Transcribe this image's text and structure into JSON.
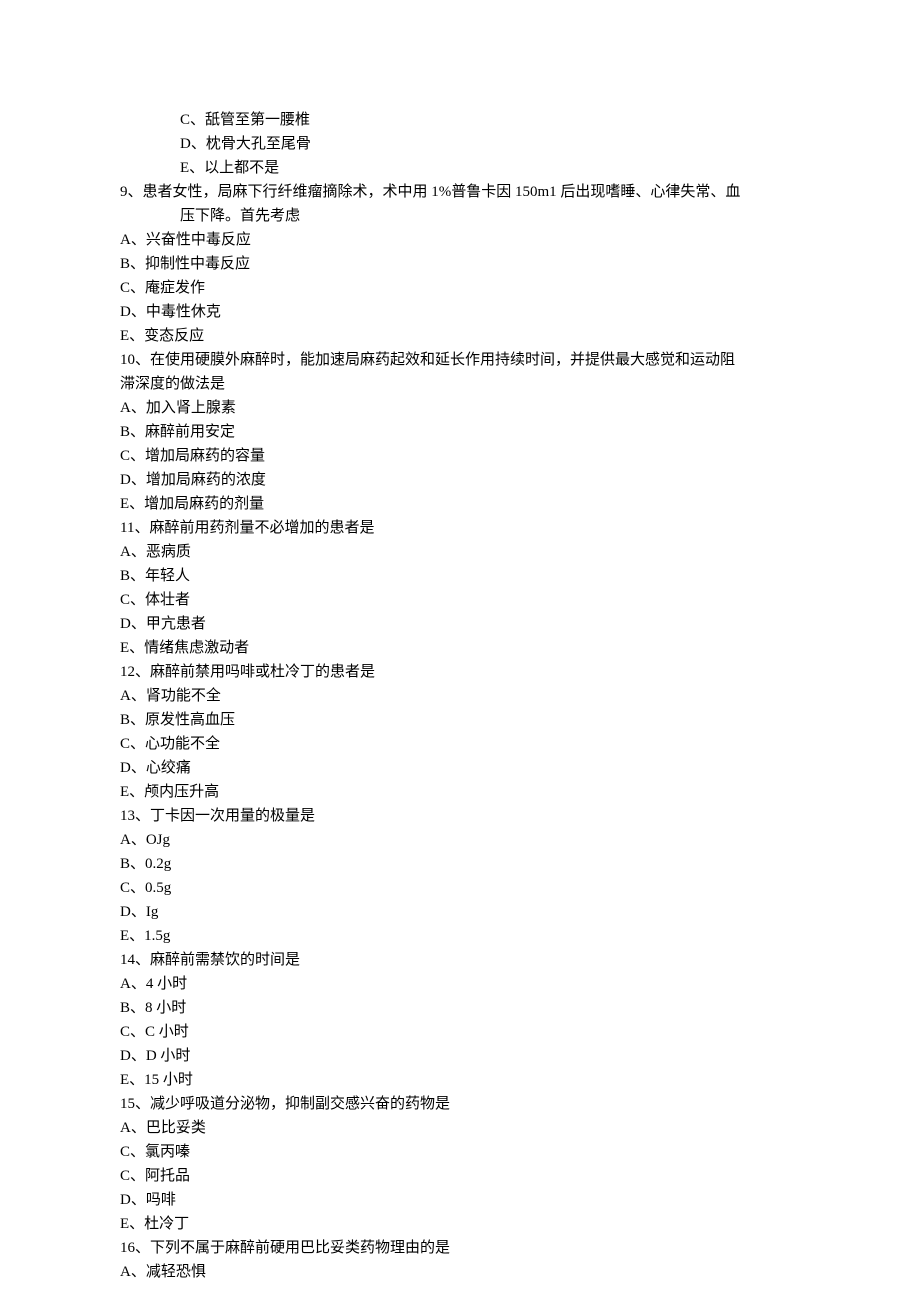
{
  "q8_tail": {
    "options": [
      "C、舐管至第一腰椎",
      "D、枕骨大孔至尾骨",
      "E、以上都不是"
    ]
  },
  "q9": {
    "stem_line1": "9、患者女性，局麻下行纤维瘤摘除术，术中用 1%普鲁卡因 150m1 后出现嗜睡、心律失常、血",
    "stem_line2": "压下降。首先考虑",
    "options": [
      "A、兴奋性中毒反应",
      "B、抑制性中毒反应",
      "C、庵症发作",
      "D、中毒性休克",
      "E、变态反应"
    ]
  },
  "q10": {
    "stem_line1": "10、在使用硬膜外麻醉时，能加速局麻药起效和延长作用持续时间，并提供最大感觉和运动阻",
    "stem_line2": "滞深度的做法是",
    "options": [
      "A、加入肾上腺素",
      "B、麻醉前用安定",
      "C、增加局麻药的容量",
      "D、增加局麻药的浓度",
      "E、增加局麻药的剂量"
    ]
  },
  "q11": {
    "stem": "11、麻醉前用药剂量不必增加的患者是",
    "options": [
      "A、恶病质",
      "B、年轻人",
      "C、体壮者",
      "D、甲亢患者",
      "E、情绪焦虑激动者"
    ]
  },
  "q12": {
    "stem": "12、麻醉前禁用吗啡或杜冷丁的患者是",
    "options": [
      "A、肾功能不全",
      "B、原发性高血压",
      "C、心功能不全",
      "D、心绞痛",
      "E、颅内压升高"
    ]
  },
  "q13": {
    "stem": "13、丁卡因一次用量的极量是",
    "options": [
      "A、OJg",
      "B、0.2g",
      "C、0.5g",
      "D、Ig",
      "E、1.5g"
    ]
  },
  "q14": {
    "stem": "14、麻醉前需禁饮的时间是",
    "options": [
      "A、4 小时",
      "B、8 小时",
      "C、C 小时",
      "D、D 小时",
      "E、15 小时"
    ]
  },
  "q15": {
    "stem": "15、减少呼吸道分泌物，抑制副交感兴奋的药物是",
    "options": [
      "A、巴比妥类",
      "C、氯丙嗪",
      "C、阿托品",
      "D、吗啡",
      "E、杜冷丁"
    ]
  },
  "q16": {
    "stem": "16、下列不属于麻醉前硬用巴比妥类药物理由的是",
    "options": [
      "A、减轻恐惧"
    ]
  }
}
